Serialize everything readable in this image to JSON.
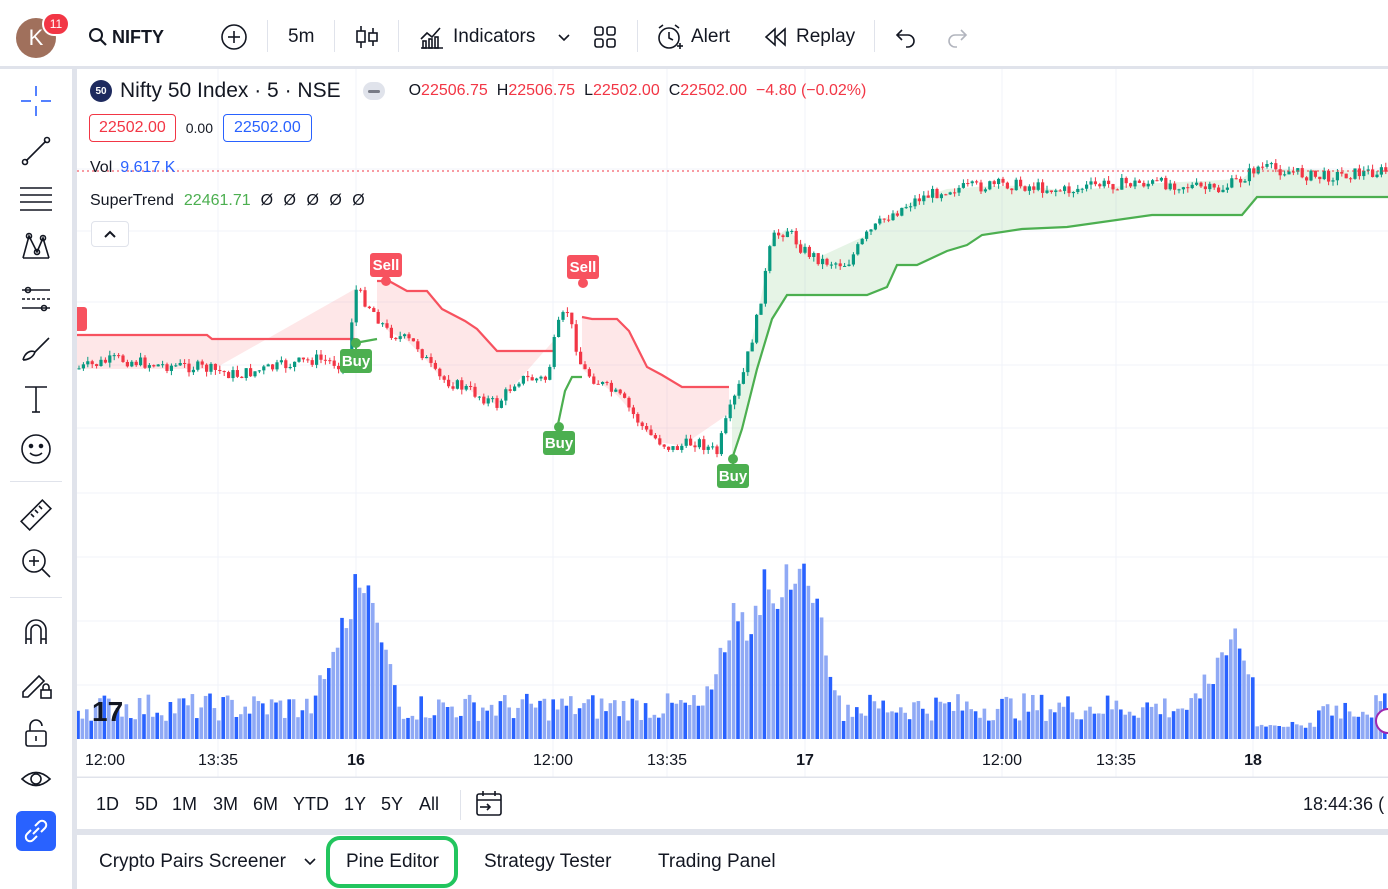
{
  "topbar": {
    "avatar_letter": "K",
    "notification_count": "11",
    "symbol": "NIFTY",
    "interval": "5m",
    "indicators_label": "Indicators",
    "alert_label": "Alert",
    "replay_label": "Replay"
  },
  "legend": {
    "symbol_badge": "50",
    "title": "Nifty 50 Index · 5 · NSE",
    "o_label": "O",
    "o_value": "22506.75",
    "h_label": "H",
    "h_value": "22506.75",
    "l_label": "L",
    "l_value": "22502.00",
    "c_label": "C",
    "c_value": "22502.00",
    "change": "−4.80 (−0.02%)",
    "bid": "22502.00",
    "spread": "0.00",
    "ask": "22502.00",
    "vol_label": "Vol",
    "vol_value": "9.617 K",
    "st_label": "SuperTrend",
    "st_value": "22461.71",
    "st_na": [
      "Ø",
      "Ø",
      "Ø",
      "Ø",
      "Ø"
    ]
  },
  "signals": {
    "sell": "Sell",
    "buy": "Buy"
  },
  "x_axis": {
    "ticks": [
      "12:00",
      "13:35",
      "16",
      "12:00",
      "13:35",
      "17",
      "12:00",
      "13:35",
      "18"
    ]
  },
  "ranges": [
    "1D",
    "5D",
    "1M",
    "3M",
    "6M",
    "YTD",
    "1Y",
    "5Y",
    "All"
  ],
  "clock": "18:44:36 (",
  "bottom_tabs": {
    "screener": "Crypto Pairs Screener",
    "pine": "Pine Editor",
    "strategy": "Strategy Tester",
    "trading": "Trading Panel"
  },
  "colors": {
    "up": "#089981",
    "down": "#f23645",
    "supertrend_up": "#4caf50",
    "supertrend_down": "#f7525f",
    "volume_dark": "#2962ff",
    "volume_light": "#8fa9f5",
    "highlight": "#22c55e"
  },
  "chart_data": {
    "type": "candlestick",
    "symbol": "Nifty 50 Index",
    "interval": "5",
    "exchange": "NSE",
    "last": {
      "open": 22506.75,
      "high": 22506.75,
      "low": 22502.0,
      "close": 22502.0,
      "change": -4.8,
      "change_pct": -0.02
    },
    "supertrend_last": 22461.71,
    "volume_last": "9.617 K",
    "signals": [
      {
        "type": "Buy",
        "at": "16 open"
      },
      {
        "type": "Sell",
        "at": "16 early"
      },
      {
        "type": "Buy",
        "at": "16 12:00"
      },
      {
        "type": "Sell",
        "at": "16 12:05"
      },
      {
        "type": "Buy",
        "at": "16 close"
      }
    ]
  }
}
